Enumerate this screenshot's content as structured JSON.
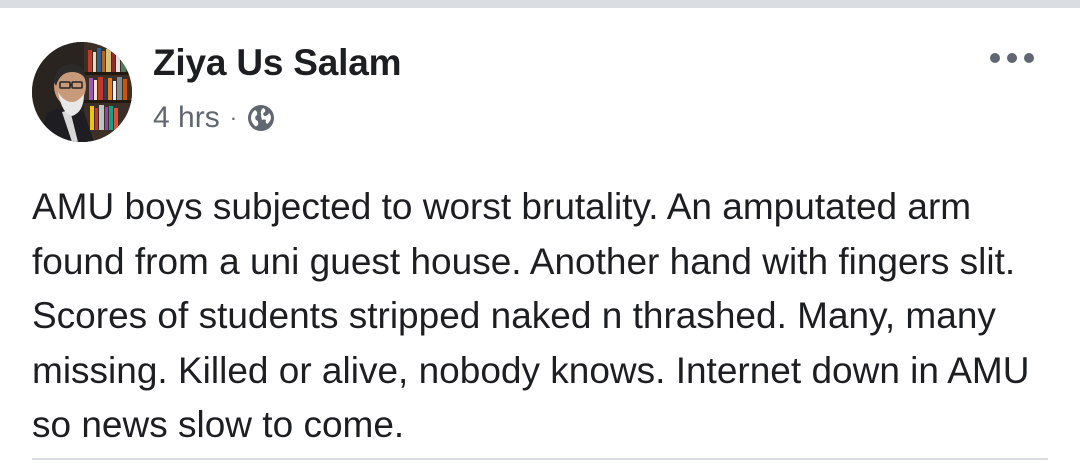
{
  "post": {
    "author": "Ziya Us Salam",
    "timestamp": "4 hrs",
    "separator": "·",
    "privacy_icon": "globe-icon",
    "avatar_icon": "profile-photo",
    "more_icon": "more-horizontal-icon",
    "body": "AMU boys subjected to worst brutality. An amputated arm found from a uni guest house. Another hand with fingers slit. Scores of students stripped naked n thrashed. Many, many missing. Killed or alive, nobody knows. Internet down in AMU so news slow to come."
  },
  "colors": {
    "text_primary": "#1c1e21",
    "text_secondary": "#606770",
    "divider": "#dadde1",
    "background": "#ffffff"
  }
}
